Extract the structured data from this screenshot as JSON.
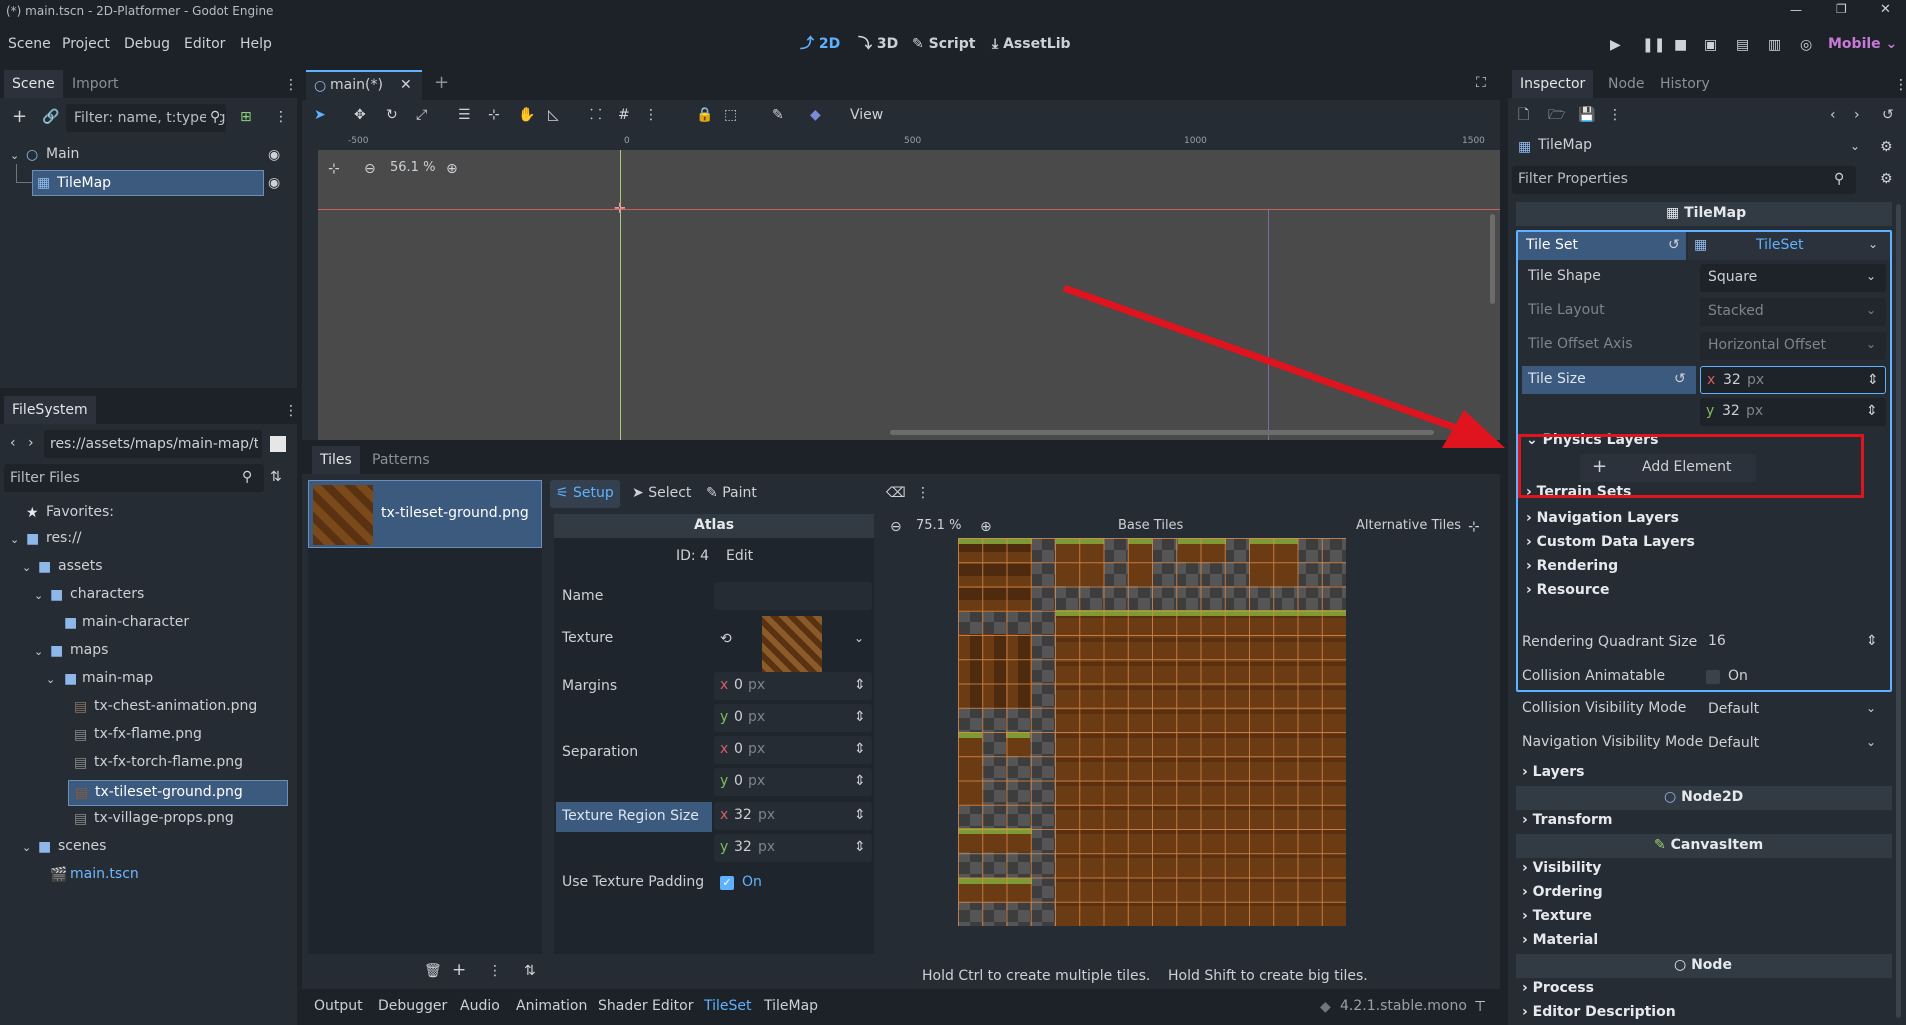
{
  "title": "(*) main.tscn - 2D-Platformer - Godot Engine",
  "menu": [
    "Scene",
    "Project",
    "Debug",
    "Editor",
    "Help"
  ],
  "workspaces": [
    "2D",
    "3D",
    "Script",
    "AssetLib"
  ],
  "renderer": "Mobile",
  "scene_dock": {
    "tabs": [
      "Scene",
      "Import"
    ],
    "filter_placeholder": "Filter: name, t:type, g",
    "nodes": [
      {
        "name": "Main"
      },
      {
        "name": "TileMap"
      }
    ]
  },
  "filesystem": {
    "tab": "FileSystem",
    "path": "res://assets/maps/main-map/tx",
    "filter_placeholder": "Filter Files",
    "items": [
      {
        "label": "Favorites:"
      },
      {
        "label": "res://"
      },
      {
        "label": "assets"
      },
      {
        "label": "characters"
      },
      {
        "label": "main-character"
      },
      {
        "label": "maps"
      },
      {
        "label": "main-map"
      },
      {
        "label": "tx-chest-animation.png"
      },
      {
        "label": "tx-fx-flame.png"
      },
      {
        "label": "tx-fx-torch-flame.png"
      },
      {
        "label": "tx-tileset-ground.png"
      },
      {
        "label": "tx-village-props.png"
      },
      {
        "label": "scenes"
      },
      {
        "label": "main.tscn"
      }
    ]
  },
  "editor_tab": "main(*)",
  "viewport": {
    "zoom": "56.1 %",
    "view_menu": "View",
    "ruler": [
      "-500",
      "0",
      "500",
      "1000",
      "1500"
    ]
  },
  "tileset_editor": {
    "tabs": [
      "Tiles",
      "Patterns"
    ],
    "atlas_item": "tx-tileset-ground.png",
    "modes": [
      "Setup",
      "Select",
      "Paint"
    ],
    "atlas_header": "Atlas",
    "id_label": "ID: 4",
    "edit": "Edit",
    "props": {
      "name": "Name",
      "texture": "Texture",
      "margins": "Margins",
      "separation": "Separation",
      "region": "Texture Region Size",
      "padding": "Use Texture Padding",
      "padding_value": "On"
    },
    "margins": {
      "x": "0",
      "y": "0"
    },
    "separation": {
      "x": "0",
      "y": "0"
    },
    "region": {
      "x": "32",
      "y": "32"
    },
    "unit": "px",
    "atlas_zoom": "75.1 %",
    "base_tiles": "Base Tiles",
    "alt_tiles": "Alternative Tiles",
    "hint1": "Hold Ctrl to create multiple tiles.",
    "hint2": "Hold Shift to create big tiles."
  },
  "bottom_tabs": [
    "Output",
    "Debugger",
    "Audio",
    "Animation",
    "Shader Editor",
    "TileSet",
    "TileMap"
  ],
  "version": "4.2.1.stable.mono",
  "inspector": {
    "tabs": [
      "Inspector",
      "Node",
      "History"
    ],
    "object": "TileMap",
    "filter_placeholder": "Filter Properties",
    "class_header": "TileMap",
    "tile_set": {
      "label": "Tile Set",
      "value": "TileSet"
    },
    "tile_shape": {
      "label": "Tile Shape",
      "value": "Square"
    },
    "tile_layout": {
      "label": "Tile Layout",
      "value": "Stacked"
    },
    "tile_offset": {
      "label": "Tile Offset Axis",
      "value": "Horizontal Offset"
    },
    "tile_size": {
      "label": "Tile Size",
      "x": "32",
      "y": "32",
      "unit": "px"
    },
    "physics": "Physics Layers",
    "add_element": "Add Element",
    "groups": [
      "Terrain Sets",
      "Navigation Layers",
      "Custom Data Layers",
      "Rendering",
      "Resource"
    ],
    "quadrant": {
      "label": "Rendering Quadrant Size",
      "value": "16"
    },
    "collision_anim": {
      "label": "Collision Animatable",
      "value": "On"
    },
    "collision_vis": {
      "label": "Collision Visibility Mode",
      "value": "Default"
    },
    "nav_vis": {
      "label": "Navigation Visibility Mode",
      "value": "Default"
    },
    "layers": "Layers",
    "node2d": "Node2D",
    "transform": "Transform",
    "canvasitem": "CanvasItem",
    "canvas_groups": [
      "Visibility",
      "Ordering",
      "Texture",
      "Material"
    ],
    "node": "Node",
    "process": "Process",
    "editor_desc": "Editor Description"
  },
  "colors": {
    "accent": "#5fb2ff",
    "highlight_red": "#e0141e",
    "grid": "#e6904d"
  }
}
